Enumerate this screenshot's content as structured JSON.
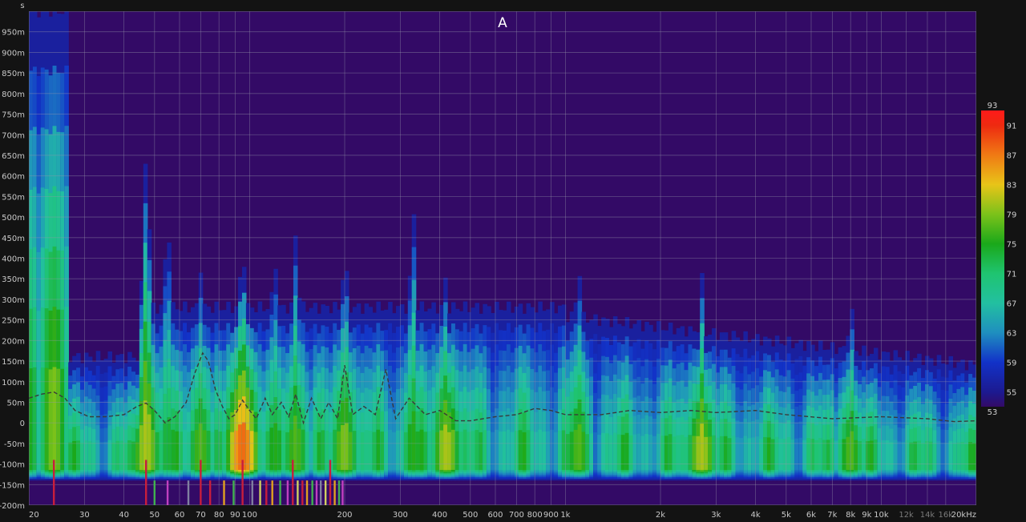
{
  "chart_data": {
    "type": "heatmap",
    "title": "A",
    "ylabel": "s",
    "xscale": "log",
    "xlim": [
      20,
      20000
    ],
    "ylim": [
      -0.2,
      1.0
    ],
    "grid": true,
    "x_ticks": [
      {
        "value": 20,
        "label": "20"
      },
      {
        "value": 30,
        "label": "30"
      },
      {
        "value": 40,
        "label": "40"
      },
      {
        "value": 50,
        "label": "50"
      },
      {
        "value": 60,
        "label": "60"
      },
      {
        "value": 70,
        "label": "70"
      },
      {
        "value": 80,
        "label": "80"
      },
      {
        "value": 90,
        "label": "90"
      },
      {
        "value": 100,
        "label": "100"
      },
      {
        "value": 200,
        "label": "200"
      },
      {
        "value": 300,
        "label": "300"
      },
      {
        "value": 400,
        "label": "400"
      },
      {
        "value": 500,
        "label": "500"
      },
      {
        "value": 600,
        "label": "600"
      },
      {
        "value": 700,
        "label": "700"
      },
      {
        "value": 800,
        "label": "800"
      },
      {
        "value": 900,
        "label": "900"
      },
      {
        "value": 1000,
        "label": "1k"
      },
      {
        "value": 2000,
        "label": "2k"
      },
      {
        "value": 3000,
        "label": "3k"
      },
      {
        "value": 4000,
        "label": "4k"
      },
      {
        "value": 5000,
        "label": "5k"
      },
      {
        "value": 6000,
        "label": "6k"
      },
      {
        "value": 7000,
        "label": "7k"
      },
      {
        "value": 8000,
        "label": "8k"
      },
      {
        "value": 9000,
        "label": "9k"
      },
      {
        "value": 10000,
        "label": "10k"
      },
      {
        "value": 12000,
        "label": "12k",
        "dim": true
      },
      {
        "value": 14000,
        "label": "14k",
        "dim": true
      },
      {
        "value": 16000,
        "label": "16k",
        "dim": true
      },
      {
        "value": 20000,
        "label": "20kHz"
      }
    ],
    "y_ticks": [
      {
        "value": 0.95,
        "label": "950m"
      },
      {
        "value": 0.9,
        "label": "900m"
      },
      {
        "value": 0.85,
        "label": "850m"
      },
      {
        "value": 0.8,
        "label": "800m"
      },
      {
        "value": 0.75,
        "label": "750m"
      },
      {
        "value": 0.7,
        "label": "700m"
      },
      {
        "value": 0.65,
        "label": "650m"
      },
      {
        "value": 0.6,
        "label": "600m"
      },
      {
        "value": 0.55,
        "label": "550m"
      },
      {
        "value": 0.5,
        "label": "500m"
      },
      {
        "value": 0.45,
        "label": "450m"
      },
      {
        "value": 0.4,
        "label": "400m"
      },
      {
        "value": 0.35,
        "label": "350m"
      },
      {
        "value": 0.3,
        "label": "300m"
      },
      {
        "value": 0.25,
        "label": "250m"
      },
      {
        "value": 0.2,
        "label": "200m"
      },
      {
        "value": 0.15,
        "label": "150m"
      },
      {
        "value": 0.1,
        "label": "100m"
      },
      {
        "value": 0.05,
        "label": "50m"
      },
      {
        "value": 0,
        "label": "0"
      },
      {
        "value": -0.05,
        "label": "-50m"
      },
      {
        "value": -0.1,
        "label": "-100m"
      },
      {
        "value": -0.15,
        "label": "-150m"
      },
      {
        "value": -0.2,
        "label": "-200m"
      }
    ],
    "colorbar": {
      "min": 53,
      "max": 93,
      "ticks": [
        {
          "value": 93,
          "label": "93"
        },
        {
          "value": 91,
          "label": "91"
        },
        {
          "value": 87,
          "label": "87"
        },
        {
          "value": 83,
          "label": "83"
        },
        {
          "value": 79,
          "label": "79"
        },
        {
          "value": 75,
          "label": "75"
        },
        {
          "value": 71,
          "label": "71"
        },
        {
          "value": 67,
          "label": "67"
        },
        {
          "value": 63,
          "label": "63"
        },
        {
          "value": 59,
          "label": "59"
        },
        {
          "value": 55,
          "label": "55"
        },
        {
          "value": 53,
          "label": "53"
        }
      ],
      "stops": [
        {
          "value": 53,
          "color": "#330a66"
        },
        {
          "value": 55,
          "color": "#1c1a90"
        },
        {
          "value": 59,
          "color": "#1232c8"
        },
        {
          "value": 63,
          "color": "#1f8fbf"
        },
        {
          "value": 67,
          "color": "#22c0a0"
        },
        {
          "value": 71,
          "color": "#1fc470"
        },
        {
          "value": 75,
          "color": "#1aa81a"
        },
        {
          "value": 79,
          "color": "#7cc21a"
        },
        {
          "value": 83,
          "color": "#e8c418"
        },
        {
          "value": 87,
          "color": "#f07a14"
        },
        {
          "value": 91,
          "color": "#ee2a10"
        },
        {
          "value": 93,
          "color": "#ff1a1a"
        }
      ]
    },
    "peak_track": [
      [
        20,
        0.06
      ],
      [
        22,
        0.07
      ],
      [
        24,
        0.075
      ],
      [
        26,
        0.06
      ],
      [
        28,
        0.03
      ],
      [
        31,
        0.015
      ],
      [
        35,
        0.015
      ],
      [
        40,
        0.02
      ],
      [
        44,
        0.04
      ],
      [
        47,
        0.048
      ],
      [
        50,
        0.03
      ],
      [
        54,
        0.0
      ],
      [
        58,
        0.015
      ],
      [
        63,
        0.05
      ],
      [
        67,
        0.12
      ],
      [
        71,
        0.17
      ],
      [
        74,
        0.15
      ],
      [
        78,
        0.08
      ],
      [
        82,
        0.04
      ],
      [
        86,
        0.01
      ],
      [
        90,
        0.02
      ],
      [
        95,
        0.055
      ],
      [
        100,
        0.03
      ],
      [
        105,
        0.01
      ],
      [
        112,
        0.06
      ],
      [
        118,
        0.02
      ],
      [
        126,
        0.05
      ],
      [
        133,
        0.015
      ],
      [
        140,
        0.07
      ],
      [
        148,
        0.0
      ],
      [
        157,
        0.06
      ],
      [
        168,
        0.01
      ],
      [
        178,
        0.05
      ],
      [
        190,
        0.01
      ],
      [
        200,
        0.14
      ],
      [
        212,
        0.02
      ],
      [
        230,
        0.04
      ],
      [
        250,
        0.02
      ],
      [
        270,
        0.13
      ],
      [
        290,
        0.01
      ],
      [
        320,
        0.06
      ],
      [
        360,
        0.02
      ],
      [
        400,
        0.03
      ],
      [
        450,
        0.005
      ],
      [
        500,
        0.005
      ],
      [
        600,
        0.015
      ],
      [
        700,
        0.02
      ],
      [
        800,
        0.035
      ],
      [
        900,
        0.03
      ],
      [
        1000,
        0.02
      ],
      [
        1300,
        0.02
      ],
      [
        1600,
        0.03
      ],
      [
        2000,
        0.025
      ],
      [
        2500,
        0.03
      ],
      [
        3000,
        0.025
      ],
      [
        4000,
        0.03
      ],
      [
        5000,
        0.02
      ],
      [
        7000,
        0.01
      ],
      [
        10000,
        0.015
      ],
      [
        14000,
        0.01
      ],
      [
        17000,
        0.003
      ],
      [
        20000,
        0.005
      ]
    ],
    "peaks": [
      {
        "f": 24,
        "t": 1.0,
        "level": 82
      },
      {
        "f": 47,
        "t": 0.65,
        "level": 84
      },
      {
        "f": 55,
        "t": 0.48,
        "level": 76
      },
      {
        "f": 70,
        "t": 0.38,
        "level": 80
      },
      {
        "f": 95,
        "t": 0.42,
        "level": 92
      },
      {
        "f": 120,
        "t": 0.4,
        "level": 78
      },
      {
        "f": 140,
        "t": 0.46,
        "level": 80
      },
      {
        "f": 200,
        "t": 0.4,
        "level": 82
      },
      {
        "f": 330,
        "t": 0.51,
        "level": 78
      },
      {
        "f": 420,
        "t": 0.36,
        "level": 84
      },
      {
        "f": 1100,
        "t": 0.38,
        "level": 80
      },
      {
        "f": 2700,
        "t": 0.35,
        "level": 84
      },
      {
        "f": 8000,
        "t": 0.28,
        "level": 80
      },
      {
        "f": 18000,
        "t": 0.13,
        "level": 72
      }
    ]
  }
}
